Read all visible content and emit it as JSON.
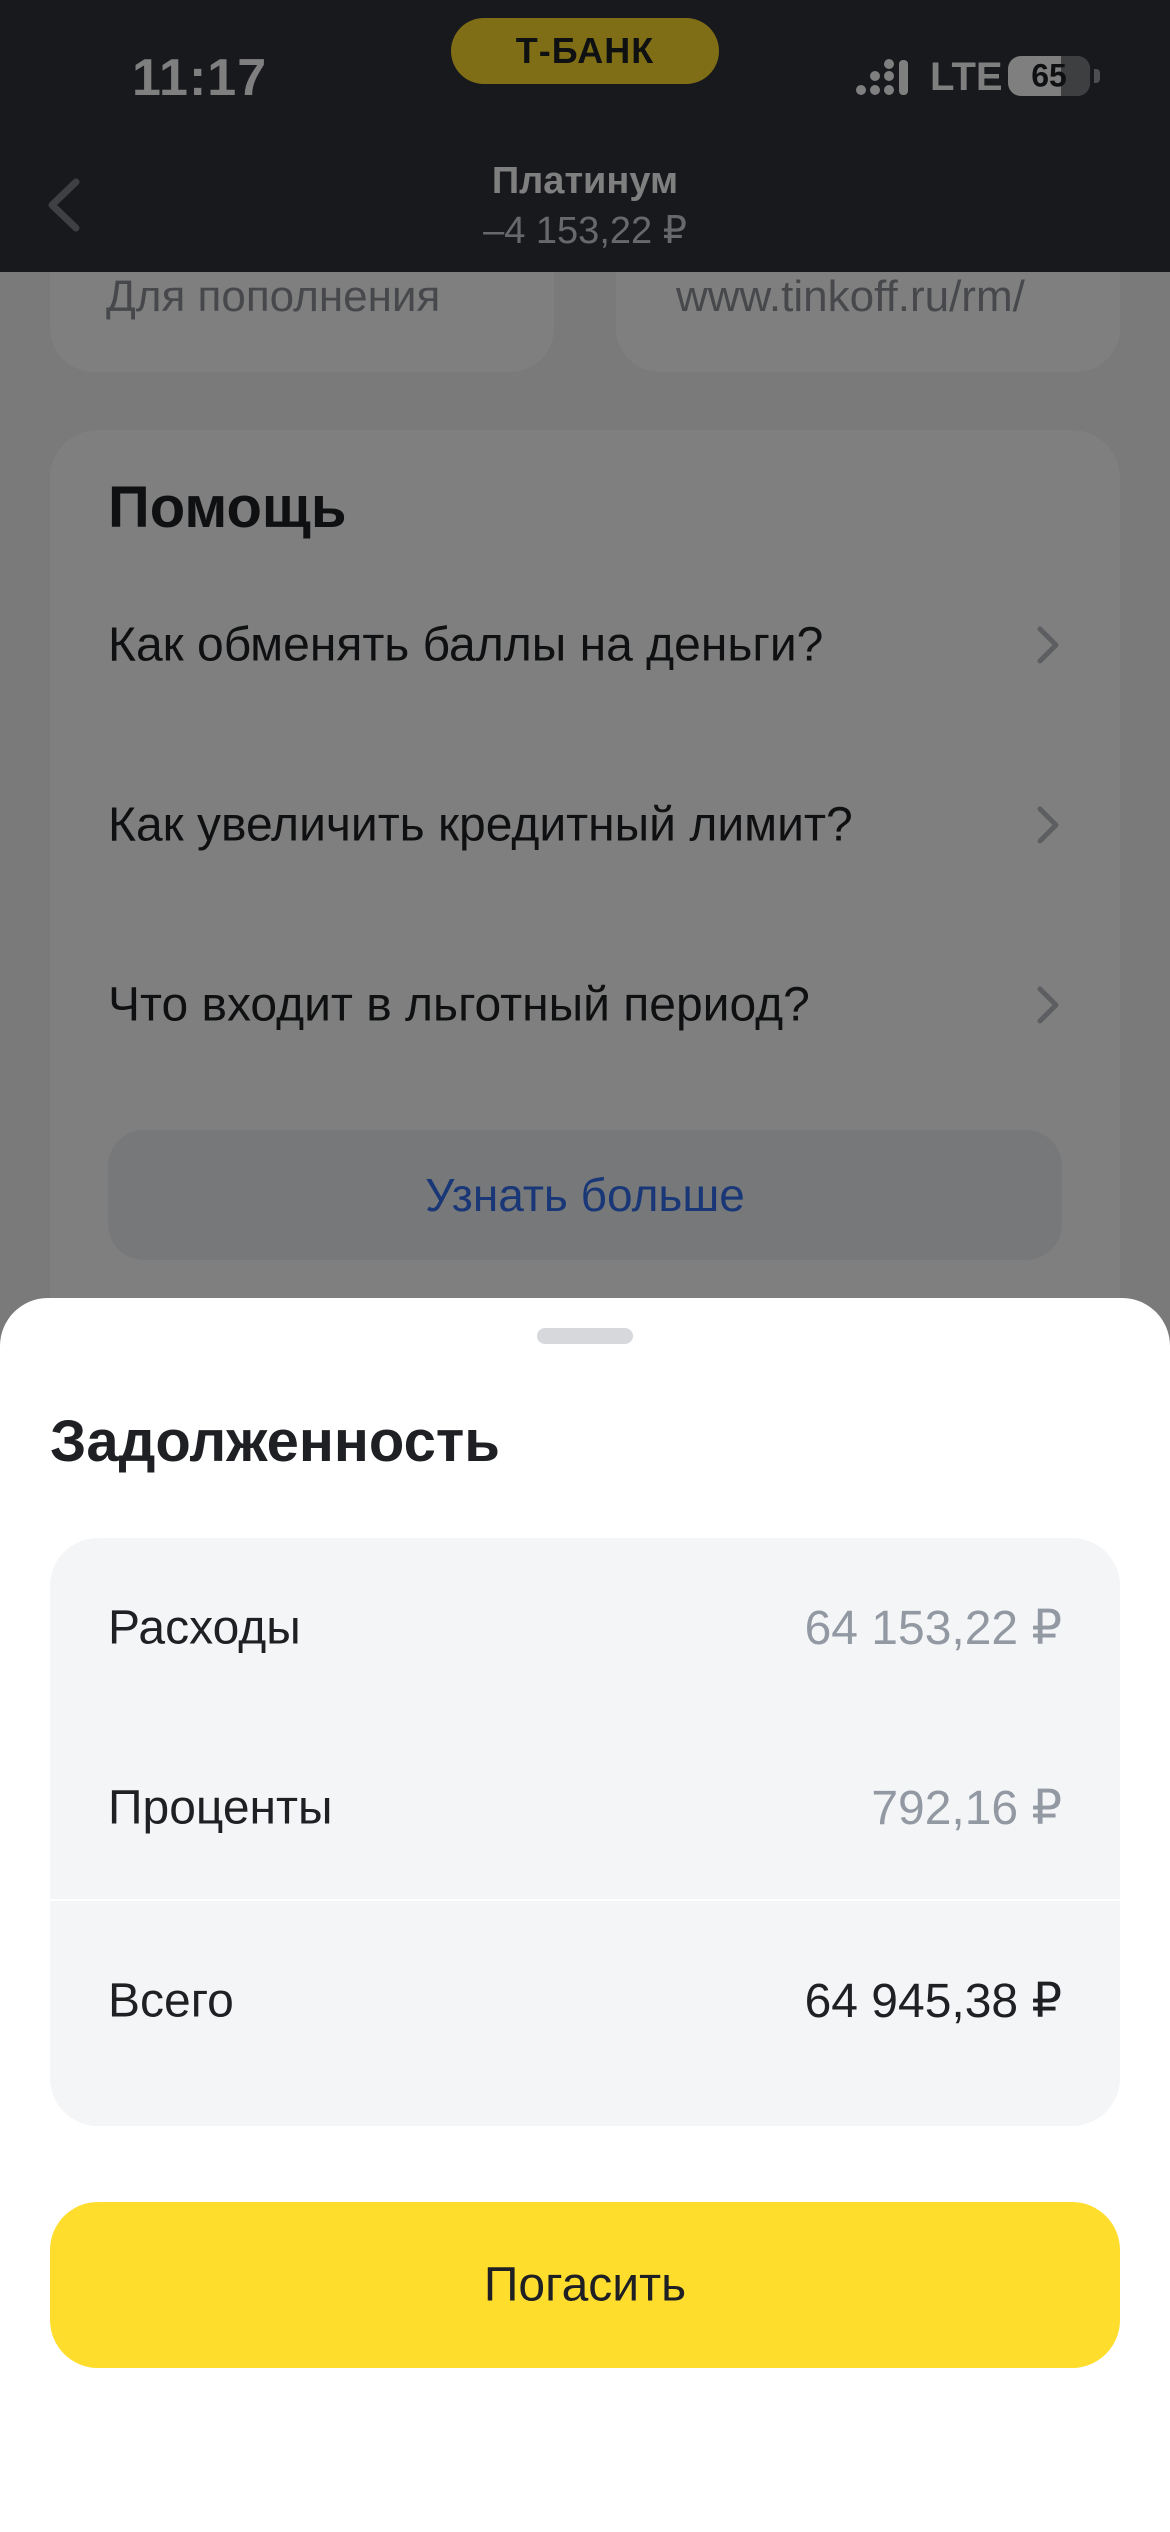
{
  "status_bar": {
    "time": "11:17",
    "brand": "Т-БАНК",
    "network": "LTE",
    "battery": "65",
    "battery_level": 0.65
  },
  "nav": {
    "title": "Платинум",
    "subtitle": "–4 153,22 ₽"
  },
  "background": {
    "cards": [
      {
        "text": "Для пополнения"
      },
      {
        "text": "www.tinkoff.ru/rm/"
      }
    ],
    "help": {
      "title": "Помощь",
      "items": [
        {
          "label": "Как обменять баллы на деньги?"
        },
        {
          "label": "Как увеличить кредитный лимит?"
        },
        {
          "label": "Что входит в льготный период?"
        }
      ],
      "more_label": "Узнать больше"
    }
  },
  "sheet": {
    "title": "Задолженность",
    "rows": [
      {
        "label": "Расходы",
        "value": "64 153,22 ₽"
      },
      {
        "label": "Проценты",
        "value": "792,16 ₽"
      }
    ],
    "total": {
      "label": "Всего",
      "value": "64 945,38 ₽"
    },
    "pay_label": "Погасить"
  },
  "colors": {
    "brand_yellow": "#ffdd2d",
    "header_bg": "#2e333b",
    "link_blue": "#336fee"
  }
}
